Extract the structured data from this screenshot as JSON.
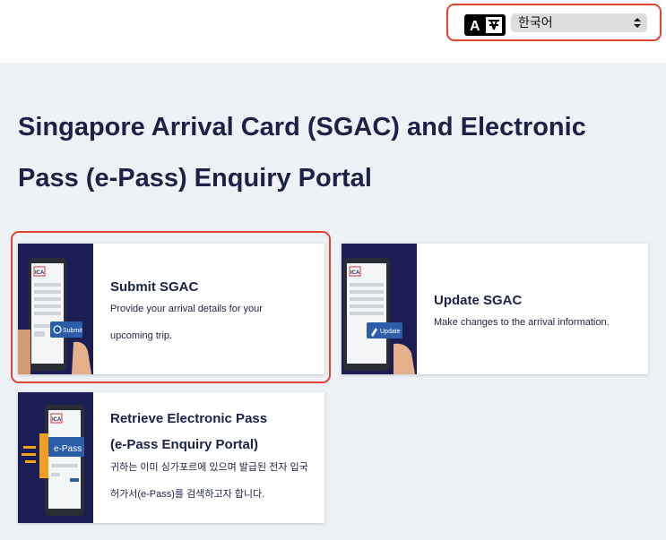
{
  "language": {
    "selected": "한국어",
    "icon_text": "A"
  },
  "page": {
    "title_line1": "Singapore Arrival Card (SGAC) and Electronic",
    "title_line2": "Pass (e-Pass) Enquiry Portal"
  },
  "cards": [
    {
      "title": "Submit SGAC",
      "desc_line1": "Provide your arrival details for your",
      "desc_line2": "upcoming trip.",
      "badge": "Submit"
    },
    {
      "title": "Update SGAC",
      "desc_line1": "Make changes to the arrival information.",
      "badge": "Update"
    },
    {
      "title_line1": "Retrieve Electronic Pass",
      "title_line2": "(e-Pass Enquiry Portal)",
      "desc_line1": "귀하는 이미 싱가포르에 있으며 발급된 전자 입국",
      "desc_line2": "허가서(e-Pass)를 검색하고자 합니다.",
      "badge": "e-Pass"
    }
  ],
  "logo_text": "ICA",
  "colors": {
    "navy": "#1b1d55",
    "highlight": "#e0452f",
    "accent_blue": "#2c5ea8",
    "accent_orange": "#f0a020"
  }
}
